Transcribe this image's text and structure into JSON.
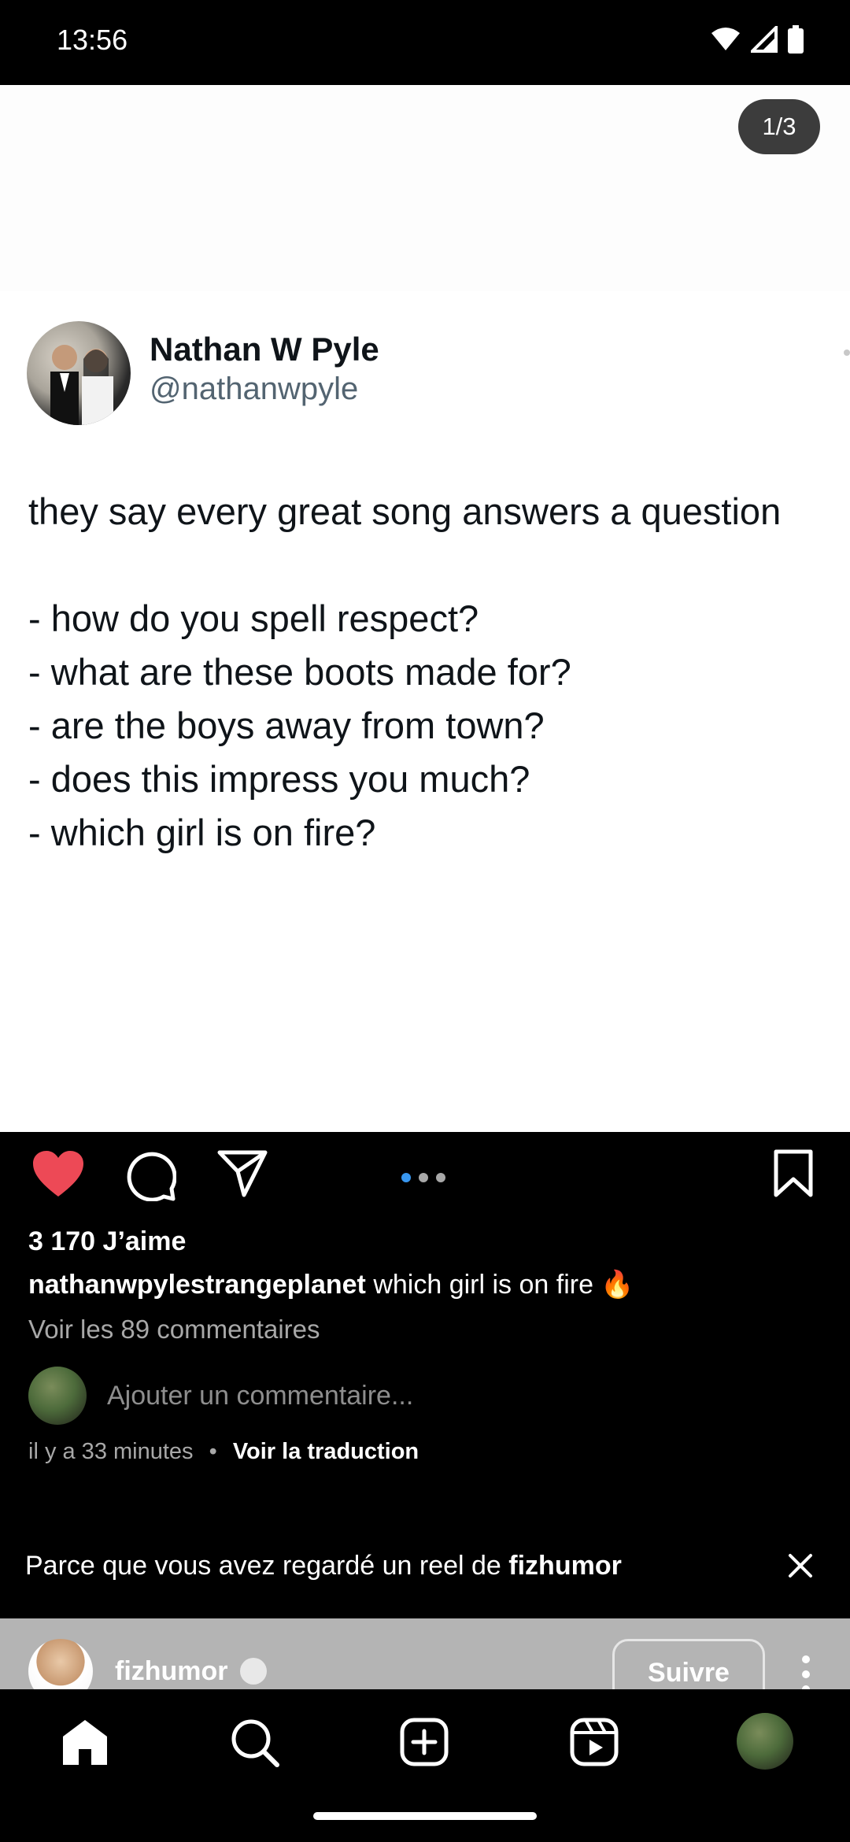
{
  "status": {
    "time": "13:56"
  },
  "post_image": {
    "counter": "1/3",
    "tweet": {
      "name": "Nathan W Pyle",
      "handle": "@nathanwpyle",
      "text": "they say every great song answers a question\n\n- how do you spell respect?\n- what are these boots made for?\n- are the boys away from town?\n- does this impress you much?\n- which girl is on fire?"
    }
  },
  "actions": {
    "like_icon": "heart-filled-icon",
    "comment_icon": "comment-icon",
    "share_icon": "paper-plane-icon",
    "save_icon": "bookmark-icon",
    "carousel_count": 3,
    "carousel_active": 0
  },
  "likes": "3 170 J’aime",
  "caption": {
    "username": "nathanwpylestrangeplanet",
    "text": "which girl is on fire 🔥"
  },
  "view_comments": "Voir les 89 commentaires",
  "add_comment_placeholder": "Ajouter un commentaire...",
  "meta": {
    "time_ago": "il y a 33 minutes",
    "separator": "•",
    "translate": "Voir la traduction"
  },
  "suggestion": {
    "prefix": "Parce que vous avez regardé un reel de ",
    "account": "fizhumor"
  },
  "next_post": {
    "username": "fizhumor",
    "follow_label": "Suivre"
  },
  "nav": [
    "home-icon",
    "search-icon",
    "create-icon",
    "reels-icon",
    "profile-avatar"
  ],
  "colors": {
    "accent_blue": "#3897f0",
    "like_red": "#ed4956"
  }
}
